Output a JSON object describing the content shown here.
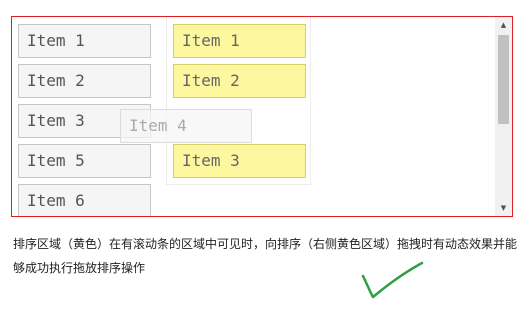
{
  "left_list": {
    "items": [
      "Item 1",
      "Item 2",
      "Item 3",
      "Item 5",
      "Item 6"
    ]
  },
  "right_list": {
    "items": [
      "Item 1",
      "Item 2",
      "Item 3"
    ]
  },
  "drag_ghost": {
    "label": "Item 4"
  },
  "description": {
    "text": "排序区域（黄色）在有滚动条的区域中可见时，向排序（右侧黄色区域）拖拽时有动态效果并能够成功执行拖放排序操作"
  },
  "scrollbar": {
    "up_arrow": "▲",
    "down_arrow": "▼"
  },
  "icons": {
    "check": "checkmark-icon"
  },
  "colors": {
    "frame_border": "#e02020",
    "item_gray_bg": "#f5f5f5",
    "item_yellow_bg": "#fdf79f",
    "checkmark": "#2ea043"
  }
}
